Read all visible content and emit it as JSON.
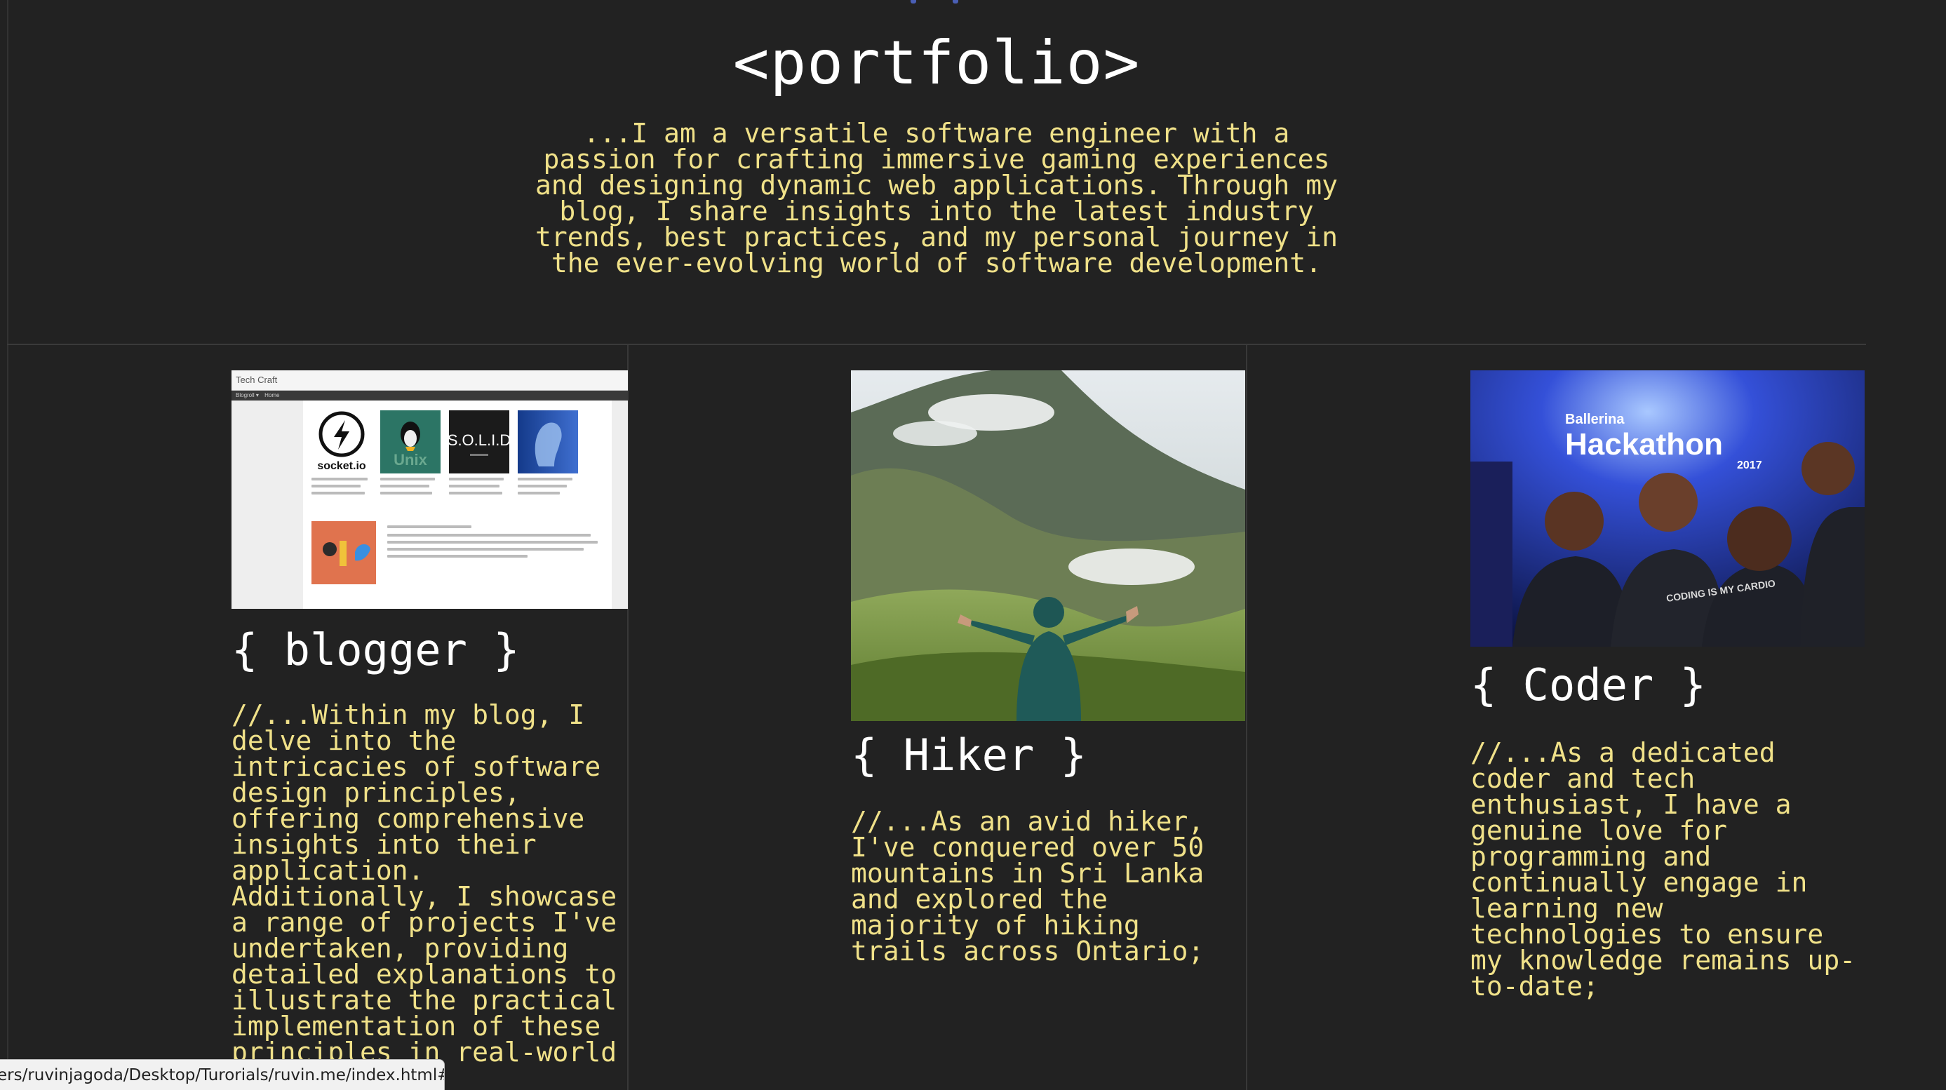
{
  "header": {
    "title": "<portfolio>",
    "intro": "...I am a versatile software engineer with a passion for crafting immersive gaming experiences and designing dynamic web applications. Through my blog, I share insights into the latest industry trends, best practices, and my personal journey in the ever-evolving world of software development."
  },
  "cards": [
    {
      "title": "{ blogger }",
      "text": "//...Within my blog, I delve into the intricacies of software design principles, offering comprehensive insights into their application. Additionally, I showcase a range of projects I've undertaken, providing detailed explanations to illustrate the practical implementation of these principles in real-world",
      "image": {
        "site_title": "Tech Craft",
        "nav_items": [
          "Blogroll ▾",
          "Home"
        ],
        "tiles": [
          "socket.io",
          "Unix",
          "S.O.L.I.D",
          ""
        ]
      }
    },
    {
      "title": "{ Hiker }",
      "text": "//...As an avid hiker, I've conquered over 50 mountains in Sri Lanka and explored the majority of hiking trails across Ontario;"
    },
    {
      "title": "{ Coder }",
      "text": "//...As a dedicated coder and tech enthusiast, I have a genuine love for programming and continually engage in learning new technologies to ensure my knowledge remains up-to-date;",
      "image": {
        "banner_brand": "Ballerina",
        "banner_word": "Hackathon",
        "banner_year": "2017",
        "shirt_text": "CODING IS MY CARDIO"
      }
    }
  ],
  "status_bar": {
    "url": "ers/ruvinjagoda/Desktop/Turorials/ruvin.me/index.html#"
  },
  "colors": {
    "background": "#222222",
    "heading": "#ffffff",
    "body_text": "#f0e189",
    "rule": "#3a3a3a"
  }
}
